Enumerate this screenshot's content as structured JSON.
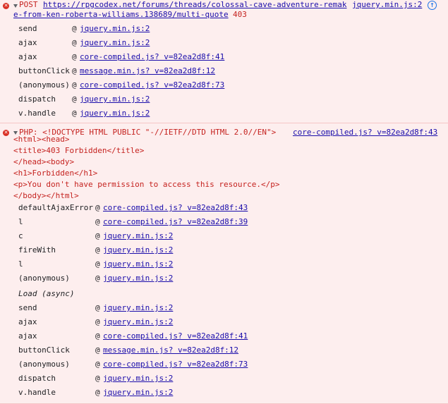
{
  "messages": [
    {
      "method": "POST",
      "url_line1": "https://rpgcodex.net/forums/threads/colossal-cave-adventure-remak",
      "url_line2": "e-from-ken-roberta-williams.138689/multi-quote",
      "status": "403",
      "source": "jquery.min.js:2",
      "stack": [
        {
          "fn": "send",
          "src": "jquery.min.js:2"
        },
        {
          "fn": "ajax",
          "src": "jquery.min.js:2"
        },
        {
          "fn": "ajax",
          "src": "core-compiled.js? v=82ea2d8f:41"
        },
        {
          "fn": "buttonClick",
          "src": "message.min.js? v=82ea2d8f:12"
        },
        {
          "fn": "(anonymous)",
          "src": "core-compiled.js? v=82ea2d8f:73"
        },
        {
          "fn": "dispatch",
          "src": "jquery.min.js:2"
        },
        {
          "fn": "v.handle",
          "src": "jquery.min.js:2"
        }
      ]
    },
    {
      "prefix": "PHP: <!DOCTYPE HTML PUBLIC \"-//IETF//DTD HTML 2.0//EN\">",
      "source": "core-compiled.js? v=82ea2d8f:43",
      "body_lines": [
        "<html><head>",
        "<title>403 Forbidden</title>",
        "</head><body>",
        "<h1>Forbidden</h1>",
        "<p>You don't have permission to access this resource.</p>",
        "</body></html>"
      ],
      "stack": [
        {
          "fn": "defaultAjaxError",
          "src": "core-compiled.js? v=82ea2d8f:43"
        },
        {
          "fn": "l",
          "src": "core-compiled.js? v=82ea2d8f:39"
        },
        {
          "fn": "c",
          "src": "jquery.min.js:2"
        },
        {
          "fn": "fireWith",
          "src": "jquery.min.js:2"
        },
        {
          "fn": "l",
          "src": "jquery.min.js:2"
        },
        {
          "fn": "(anonymous)",
          "src": "jquery.min.js:2"
        }
      ],
      "async_label": "Load (async)",
      "stack_async": [
        {
          "fn": "send",
          "src": "jquery.min.js:2"
        },
        {
          "fn": "ajax",
          "src": "jquery.min.js:2"
        },
        {
          "fn": "ajax",
          "src": "core-compiled.js? v=82ea2d8f:41"
        },
        {
          "fn": "buttonClick",
          "src": "message.min.js? v=82ea2d8f:12"
        },
        {
          "fn": "(anonymous)",
          "src": "core-compiled.js? v=82ea2d8f:73"
        },
        {
          "fn": "dispatch",
          "src": "jquery.min.js:2"
        },
        {
          "fn": "v.handle",
          "src": "jquery.min.js:2"
        }
      ]
    }
  ],
  "at_sign": "@",
  "colors": {
    "error_bg": "#fdeeee",
    "error_text": "#c5221f",
    "link": "#1a0dab",
    "error_icon": "#d93025"
  }
}
